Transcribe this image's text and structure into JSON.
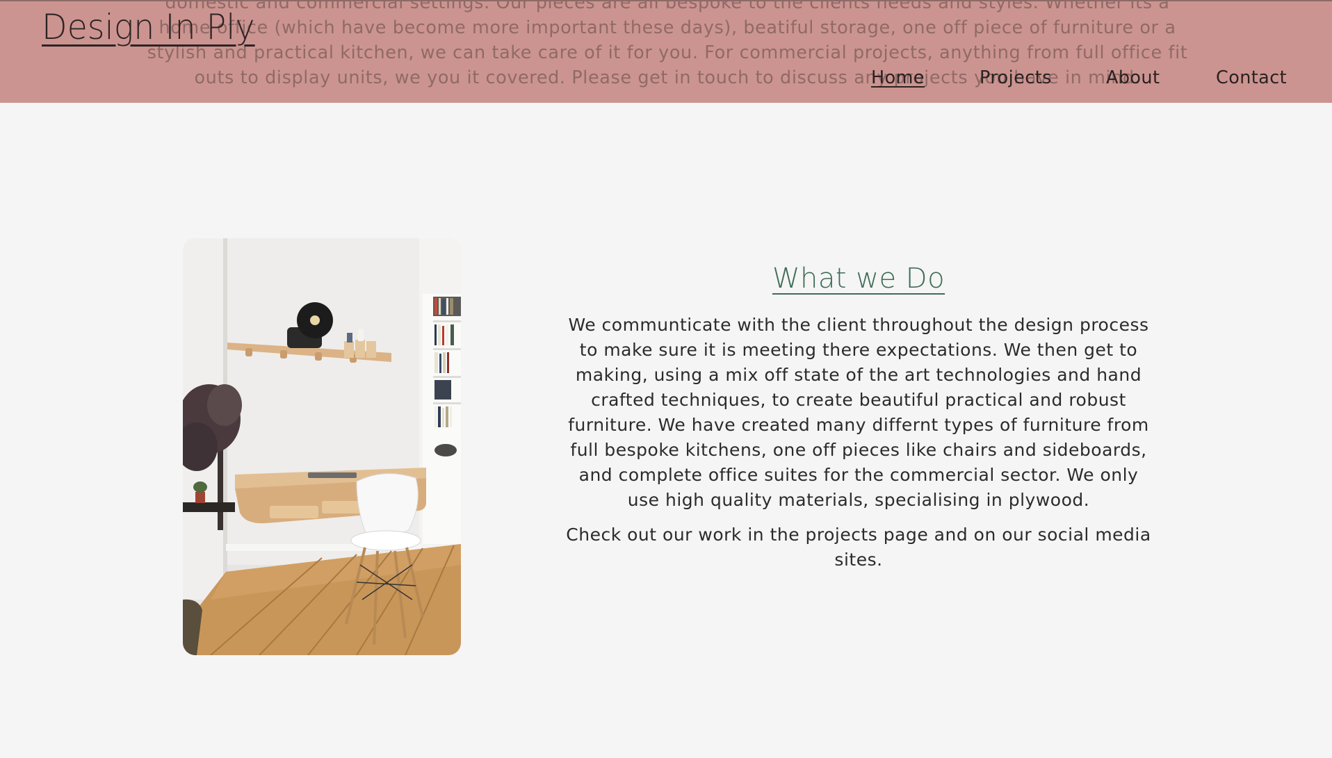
{
  "colors": {
    "header_bg": "#cc9490",
    "page_bg": "#f5f5f5",
    "title_accent": "#3f6b57",
    "bleed_text": "#8f6a67"
  },
  "header": {
    "logo": "Design In Ply",
    "bleed_text": "domestic and commercial settings. Our pieces are all bespoke to the clients needs and styles. Whether its a home office (which have become more important these days), beatiful storage, one off piece of furniture or a stylish and practical kitchen, we can take care of it for you. For commercial projects, anything from full office fit outs to display units, we you it covered. Please get in touch to discuss any projects you have in mind."
  },
  "nav": {
    "items": [
      {
        "label": "Home",
        "active": true
      },
      {
        "label": "Projects",
        "active": false
      },
      {
        "label": "About",
        "active": false
      },
      {
        "label": "Contact",
        "active": false
      }
    ]
  },
  "main": {
    "photo_alt": "plywood desk",
    "title": "What we Do",
    "paragraphs": [
      "We communticate with the client throughout the design process to make sure it is meeting there expectations. We then get to making, using a mix off state of the art technologies and hand crafted techniques, to create beautiful practical and robust furniture. We have created many differnt types of furniture from full bespoke kitchens, one off pieces like chairs and sideboards, and complete office suites for the commercial sector. We only use high quality materials, specialising in plywood.",
      "Check out our work in the projects page and on our social media sites."
    ]
  }
}
